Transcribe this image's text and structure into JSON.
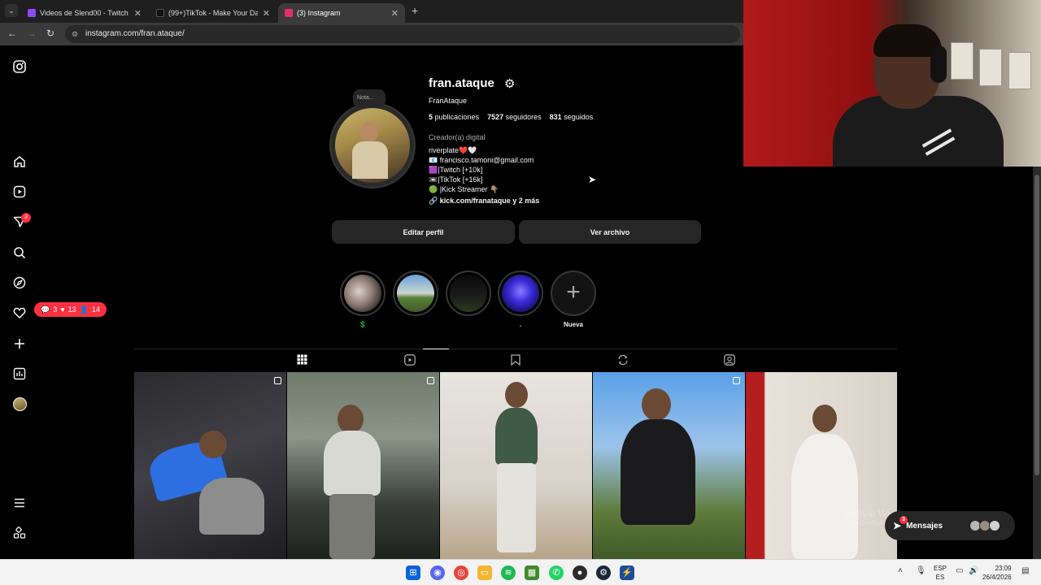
{
  "browser": {
    "tabs": [
      {
        "label": "Videos de Slend00 - Twitch",
        "favicon_color": "#9146ff",
        "active": false
      },
      {
        "label": "(99+)TikTok - Make Your Day",
        "favicon_color": "#111111",
        "active": false
      },
      {
        "label": "(3) Instagram",
        "favicon_color": "#e1306c",
        "active": true
      }
    ],
    "url": "instagram.com/fran.ataque/"
  },
  "sidebar": {
    "notif_badge": "3",
    "notification_pill": {
      "comments": "3",
      "likes": "13",
      "follows": "14"
    }
  },
  "profile": {
    "note_label": "Nota...",
    "username": "fran.ataque",
    "full_name": "FranAtaque",
    "posts_count": "5",
    "posts_label": "publicaciones",
    "followers_count": "7527",
    "followers_label": "seguidores",
    "following_count": "831",
    "following_label": "seguidos",
    "category": "Creador(a) digital",
    "bio_lines": [
      "riverplate❤️🤍",
      "📧 francisco.tamoni@gmail.com",
      "🟪|Twitch [+10k]",
      "📼|TikTok [+16k]",
      "🟢 |Kick Streamer 👇🏽"
    ],
    "link_text": "kick.com/franataque y 2 más",
    "edit_button": "Editar perfil",
    "archive_button": "Ver archivo"
  },
  "highlights": [
    {
      "label": "💲"
    },
    {
      "label": ""
    },
    {
      "label": ""
    },
    {
      "label": "."
    },
    {
      "label": "Nueva"
    }
  ],
  "messages": {
    "label": "Mensajes",
    "badge": "3"
  },
  "watermark": {
    "title": "Activar Windows",
    "subtitle": "Ve a Configuración para activar Windows."
  },
  "taskbar": {
    "lang_top": "ESP",
    "lang_bottom": "ES",
    "time": "23:09",
    "date": "26/4/2026"
  }
}
